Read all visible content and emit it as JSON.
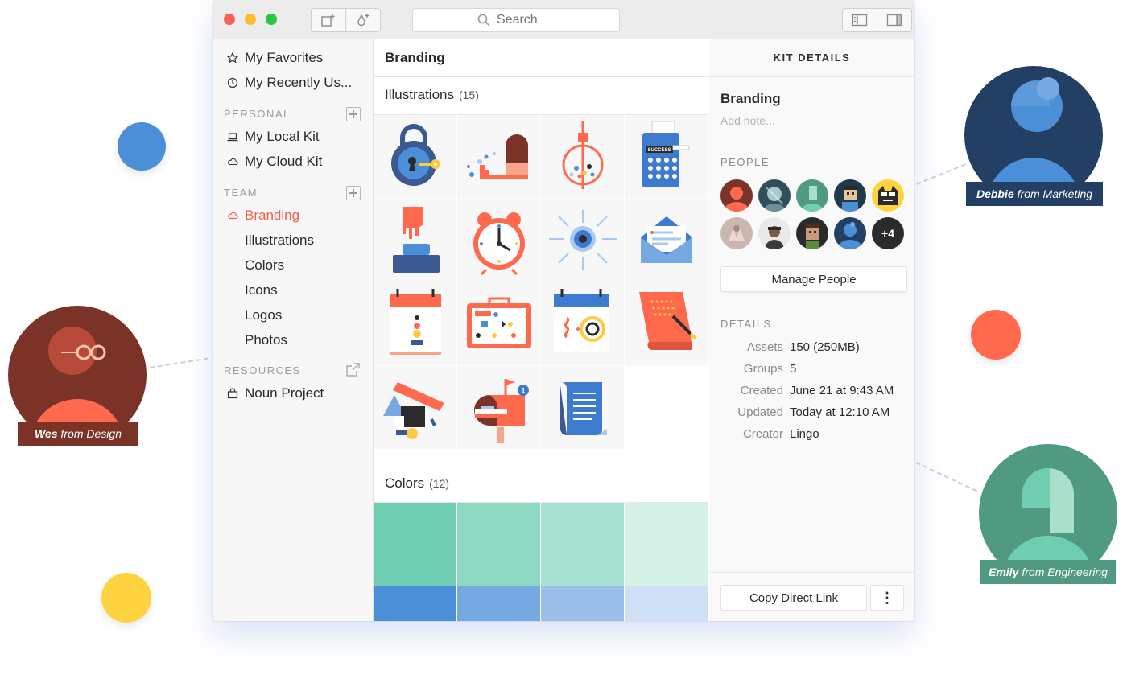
{
  "window": {
    "search_placeholder": "Search"
  },
  "sidebar": {
    "top_items": [
      {
        "label": "My Favorites",
        "icon": "star-icon"
      },
      {
        "label": "My Recently Us...",
        "icon": "clock-icon"
      }
    ],
    "personal_label": "PERSONAL",
    "personal_items": [
      {
        "label": "My Local Kit",
        "icon": "laptop-icon"
      },
      {
        "label": "My Cloud Kit",
        "icon": "cloud-icon"
      }
    ],
    "team_label": "TEAM",
    "team_active": {
      "label": "Branding",
      "icon": "cloud-icon",
      "color": "#f0624a"
    },
    "team_sub": [
      "Illustrations",
      "Colors",
      "Icons",
      "Logos",
      "Photos"
    ],
    "resources_label": "RESOURCES",
    "resources_items": [
      {
        "label": "Noun Project",
        "icon": "bag-icon"
      }
    ]
  },
  "main": {
    "title": "Branding",
    "illustrations_label": "Illustrations",
    "illustrations_count": "(15)",
    "colors_label": "Colors",
    "colors_count": "(12)",
    "swatches_row1": [
      "#6fcdb1",
      "#8dd8c1",
      "#a9e2d2",
      "#d6f1e8"
    ],
    "swatches_row2": [
      "#4a8fd8",
      "#76a9e2",
      "#99bfea",
      "#cfdff5"
    ]
  },
  "details": {
    "header": "KIT DETAILS",
    "kit_name": "Branding",
    "note_placeholder": "Add note...",
    "people_label": "PEOPLE",
    "more_people": "+4",
    "manage_button": "Manage People",
    "details_label": "DETAILS",
    "rows": [
      {
        "key": "Assets",
        "value": "150 (250MB)"
      },
      {
        "key": "Groups",
        "value": "5"
      },
      {
        "key": "Created",
        "value": "June 21 at 9:43 AM"
      },
      {
        "key": "Updated",
        "value": "Today at 12:10 AM"
      },
      {
        "key": "Creator",
        "value": "Lingo"
      }
    ],
    "copy_link_button": "Copy Direct Link",
    "more_button": "⋮"
  },
  "personas": [
    {
      "name": "Wes",
      "from": "from Design",
      "color": "#7b3328"
    },
    {
      "name": "Debbie",
      "from": "from Marketing",
      "color": "#233f63"
    },
    {
      "name": "Emily",
      "from": "from Engineering",
      "color": "#4f9a80"
    }
  ],
  "colors": {
    "accent": "#f0624a",
    "dot_blue": "#4a8fd8",
    "dot_red": "#ff6a4f",
    "dot_yellow": "#ffd23f"
  }
}
